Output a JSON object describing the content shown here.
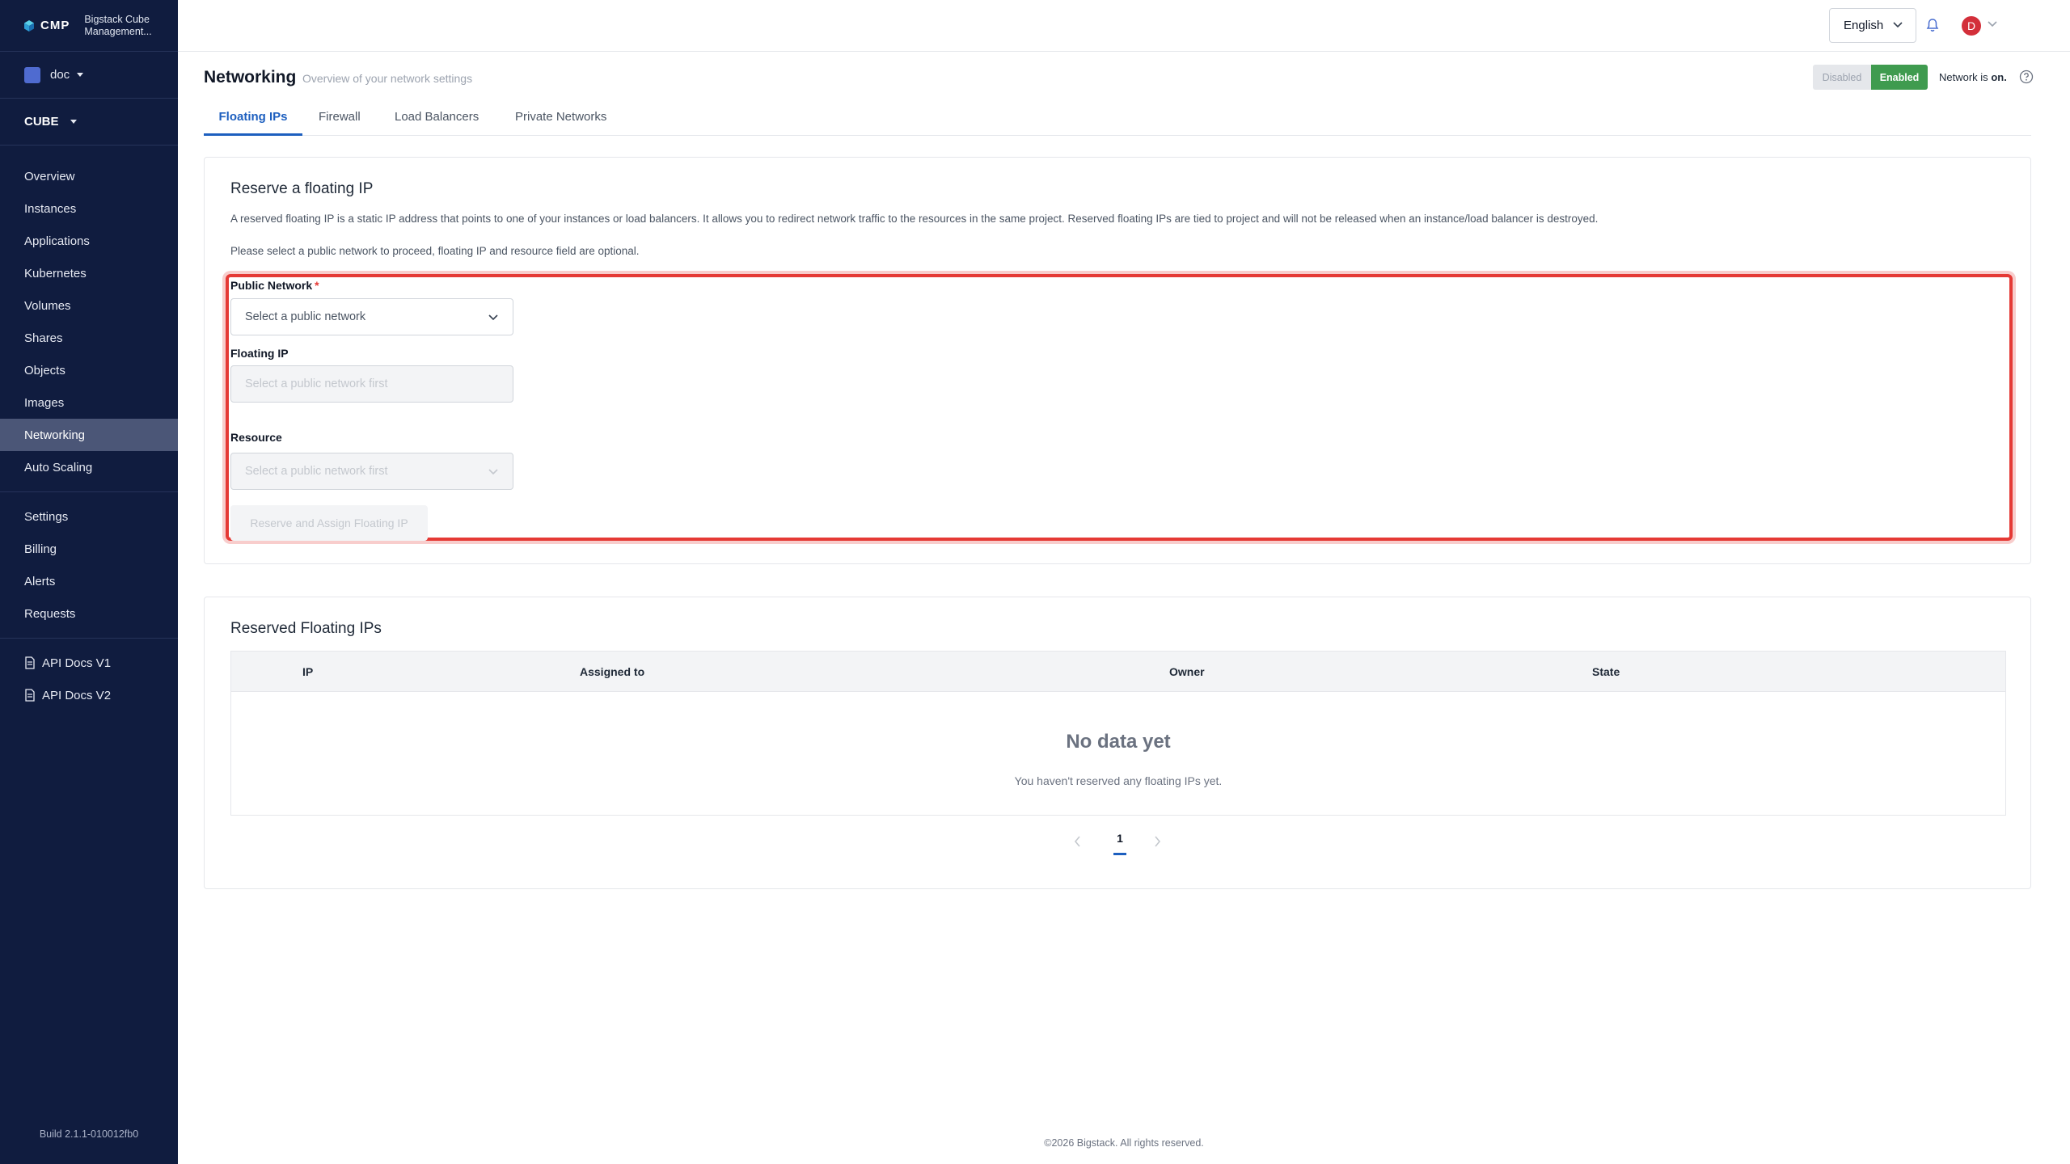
{
  "brand": {
    "logo": "CMP",
    "title_line1": "Bigstack Cube",
    "title_line2": "Management..."
  },
  "project": {
    "name": "doc"
  },
  "region": {
    "name": "CUBE"
  },
  "sidebar": {
    "items": [
      {
        "label": "Overview"
      },
      {
        "label": "Instances"
      },
      {
        "label": "Applications"
      },
      {
        "label": "Kubernetes"
      },
      {
        "label": "Volumes"
      },
      {
        "label": "Shares"
      },
      {
        "label": "Objects"
      },
      {
        "label": "Images"
      },
      {
        "label": "Networking"
      },
      {
        "label": "Auto Scaling"
      }
    ],
    "items2": [
      {
        "label": "Settings"
      },
      {
        "label": "Billing"
      },
      {
        "label": "Alerts"
      },
      {
        "label": "Requests"
      }
    ],
    "docs": [
      {
        "label": "API Docs V1"
      },
      {
        "label": "API Docs V2"
      }
    ],
    "build": "Build 2.1.1-010012fb0"
  },
  "topbar": {
    "language": "English",
    "avatar_initial": "D"
  },
  "page": {
    "title": "Networking",
    "subtitle": "Overview of your network settings",
    "toggle_off": "Disabled",
    "toggle_on": "Enabled",
    "status_prefix": "Network is",
    "status_value": "on."
  },
  "tabs": [
    {
      "label": "Floating IPs"
    },
    {
      "label": "Firewall"
    },
    {
      "label": "Load Balancers"
    },
    {
      "label": "Private Networks"
    }
  ],
  "reserve": {
    "title": "Reserve a floating IP",
    "description": "A reserved floating IP is a static IP address that points to one of your instances or load balancers. It allows you to redirect network traffic to the resources in the same project. Reserved floating IPs are tied to project and will not be released when an instance/load balancer is destroyed.",
    "note": "Please select a public network to proceed, floating IP and resource field are optional.",
    "public_network_label": "Public Network",
    "required_mark": "*",
    "public_network_placeholder": "Select a public network",
    "floating_ip_label": "Floating IP",
    "floating_ip_placeholder": "Select a public network first",
    "resource_label": "Resource",
    "resource_placeholder": "Select a public network first",
    "submit_label": "Reserve and Assign Floating IP"
  },
  "reserved": {
    "title": "Reserved Floating IPs",
    "columns": [
      "IP",
      "Assigned to",
      "Owner",
      "State"
    ],
    "empty_title": "No data yet",
    "empty_sub": "You haven't reserved any floating IPs yet.",
    "page": "1"
  },
  "footer": "©2026 Bigstack. All rights reserved.",
  "colors": {
    "sidebar": "#101c3f",
    "accent": "#1d5fbf",
    "enabled": "#3f9b4f",
    "highlight": "#e53935"
  }
}
